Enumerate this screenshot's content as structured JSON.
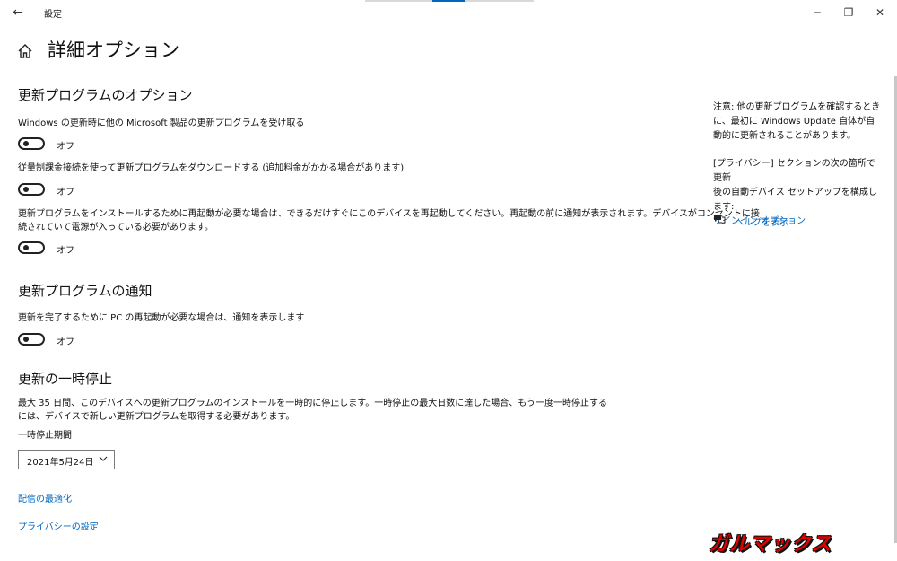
{
  "window": {
    "title": "設定",
    "back_glyph": "←",
    "minimize_glyph": "─",
    "restore_glyph": "❐",
    "close_glyph": "✕"
  },
  "page": {
    "title": "詳細オプション"
  },
  "update_options": {
    "heading": "更新プログラムのオプション",
    "items": [
      {
        "label": "Windows の更新時に他の Microsoft 製品の更新プログラムを受け取る",
        "state": "オフ"
      },
      {
        "label": "従量制課金接続を使って更新プログラムをダウンロードする (追加料金がかかる場合があります)",
        "state": "オフ"
      },
      {
        "label_line1": "更新プログラムをインストールするために再起動が必要な場合は、できるだけすぐにこのデバイスを再起動してください。再起動の前に通知が表示されます。デバイスがコンセントに接",
        "label_line2": "続されていて電源が入っている必要があります。",
        "state": "オフ"
      }
    ]
  },
  "notifications": {
    "heading": "更新プログラムの通知",
    "label": "更新を完了するために PC の再起動が必要な場合は、通知を表示します",
    "state": "オフ"
  },
  "pause": {
    "heading": "更新の一時停止",
    "desc_line1": "最大 35 日間、このデバイスへの更新プログラムのインストールを一時的に停止します。一時停止の最大日数に達した場合、もう一度一時停止する",
    "desc_line2": "には、デバイスで新しい更新プログラムを取得する必要があります。",
    "period_label": "一時停止期間",
    "selected_date": "2021年5月24日"
  },
  "links": {
    "delivery": "配信の最適化",
    "privacy": "プライバシーの設定"
  },
  "sidebar": {
    "note_line1": "注意: 他の更新プログラムを確認するとき",
    "note_line2": "に、最初に Windows Update 自体が自",
    "note_line3": "動的に更新されることがあります。",
    "privacy_line1": "[プライバシー] セクションの次の箇所で更新",
    "privacy_line2": "後の自動デバイス セットアップを構成します:",
    "signin_link": "サインイン オプション",
    "help_link": "ヘルプを表示"
  },
  "watermark": {
    "text": "ガルマックス"
  },
  "colors": {
    "accent": "#0067c0",
    "text": "#111111",
    "background": "#ffffff"
  }
}
